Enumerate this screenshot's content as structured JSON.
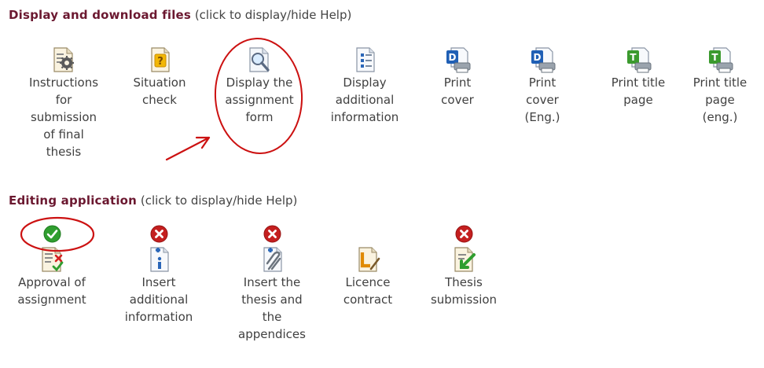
{
  "sections": {
    "display": {
      "title": "Display and download files",
      "hint": "(click to display/hide Help)",
      "items": [
        {
          "label": "Instructions for submission of final thesis",
          "icon": "document-gear-icon"
        },
        {
          "label": "Situation check",
          "icon": "document-question-icon"
        },
        {
          "label": "Display the assignment form",
          "icon": "document-magnifier-icon"
        },
        {
          "label": "Display additional information",
          "icon": "document-info-icon"
        },
        {
          "label": "Print cover",
          "icon": "word-print-icon"
        },
        {
          "label": "Print cover (Eng.)",
          "icon": "word-print-icon"
        },
        {
          "label": "Print title page",
          "icon": "title-print-icon"
        },
        {
          "label": "Print title page (eng.)",
          "icon": "title-print-icon"
        }
      ]
    },
    "editing": {
      "title": "Editing application",
      "hint": "(click to display/hide Help)",
      "items": [
        {
          "label": "Approval of assignment",
          "icon": "document-approve-icon",
          "status": "done",
          "status_icon": "check-icon"
        },
        {
          "label": "Insert additional information",
          "icon": "document-insert-info-icon",
          "status": "missing",
          "status_icon": "cross-icon"
        },
        {
          "label": "Insert the thesis and the appendices",
          "icon": "document-attach-icon",
          "status": "missing",
          "status_icon": "cross-icon"
        },
        {
          "label": "Licence contract",
          "icon": "licence-contract-icon",
          "status": "none"
        },
        {
          "label": "Thesis submission",
          "icon": "thesis-submit-icon",
          "status": "missing",
          "status_icon": "cross-icon"
        }
      ]
    }
  },
  "colors": {
    "section_title": "#6b1830",
    "annotation_red": "#cc1111",
    "status_ok": "#2f9e2f",
    "status_missing": "#c41f1f"
  }
}
